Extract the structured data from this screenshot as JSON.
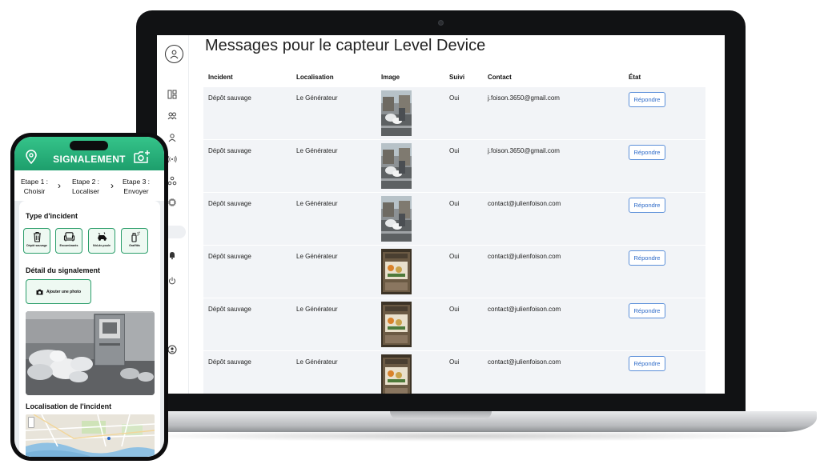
{
  "laptop": {
    "page_title": "Messages pour le capteur Level Device",
    "sidebar": {
      "logo_icon": "user-badge-icon",
      "icons": [
        "dashboard-icon",
        "users-group-icon",
        "user-icon",
        "sensor-signal-icon",
        "network-icon",
        "chip-icon",
        "toggle-icon",
        "bell-icon",
        "power-icon",
        "account-icon"
      ]
    },
    "table": {
      "headers": {
        "incident": "Incident",
        "localisation": "Localisation",
        "image": "Image",
        "suivi": "Suivi",
        "contact": "Contact",
        "etat": "État"
      },
      "rows": [
        {
          "incident": "Dépôt sauvage",
          "localisation": "Le Générateur",
          "suivi": "Oui",
          "contact": "j.foison.3650@gmail.com",
          "action": "Répondre"
        },
        {
          "incident": "Dépôt sauvage",
          "localisation": "Le Générateur",
          "suivi": "Oui",
          "contact": "j.foison.3650@gmail.com",
          "action": "Répondre"
        },
        {
          "incident": "Dépôt sauvage",
          "localisation": "Le Générateur",
          "suivi": "Oui",
          "contact": "contact@julienfoison.com",
          "action": "Répondre"
        },
        {
          "incident": "Dépôt sauvage",
          "localisation": "Le Générateur",
          "suivi": "Oui",
          "contact": "contact@julienfoison.com",
          "action": "Répondre"
        },
        {
          "incident": "Dépôt sauvage",
          "localisation": "Le Générateur",
          "suivi": "Oui",
          "contact": "contact@julienfoison.com",
          "action": "Répondre"
        },
        {
          "incident": "Dépôt sauvage",
          "localisation": "Le Générateur",
          "suivi": "Oui",
          "contact": "contact@julienfoison.com",
          "action": "Répondre"
        }
      ]
    }
  },
  "phone": {
    "header_title": "SIGNALEMENT",
    "steps": [
      {
        "line1": "Etape 1 :",
        "line2": "Choisir"
      },
      {
        "line1": "Etape 2 :",
        "line2": "Localiser"
      },
      {
        "line1": "Etape 3 :",
        "line2": "Envoyer"
      }
    ],
    "type_heading": "Type d'incident",
    "types": [
      {
        "label": "Dépôt sauvage",
        "icon": "trash-icon"
      },
      {
        "label": "Encombrants",
        "icon": "sofa-icon"
      },
      {
        "label": "Nid-de-poule",
        "icon": "pothole-car-icon"
      },
      {
        "label": "Graffitis",
        "icon": "spray-can-icon"
      }
    ],
    "detail_heading": "Détail du signalement",
    "photo_button": "Ajouter une photo",
    "location_heading": "Localisation de l'incident"
  },
  "colors": {
    "brand_green": "#1d9e6c",
    "button_blue": "#2e6bc8"
  }
}
